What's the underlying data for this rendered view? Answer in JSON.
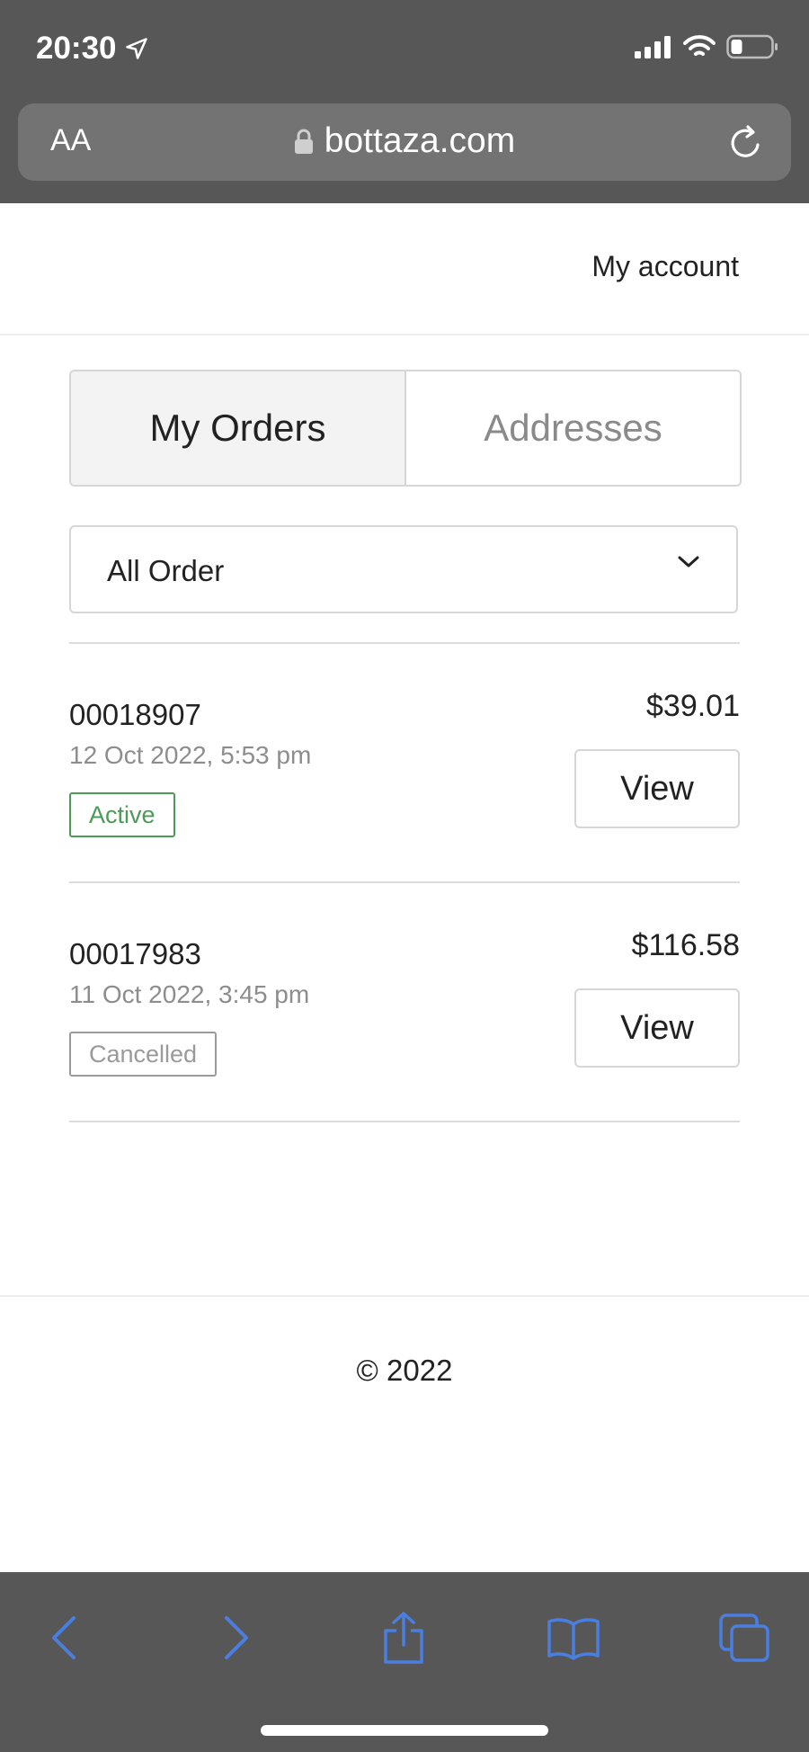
{
  "status_bar": {
    "time": "20:30",
    "icons": [
      "location-arrow-icon",
      "signal-icon",
      "wifi-icon",
      "battery-icon"
    ]
  },
  "url_bar": {
    "text_size_label": "AA",
    "domain": "bottaza.com",
    "icons": [
      "lock-icon",
      "reload-icon"
    ]
  },
  "header": {
    "account_link": "My account"
  },
  "tabs": [
    {
      "label": "My Orders",
      "active": true
    },
    {
      "label": "Addresses",
      "active": false
    }
  ],
  "filter": {
    "selected": "All Order"
  },
  "orders": [
    {
      "number": "00018907",
      "date": "12 Oct 2022, 5:53 pm",
      "status": "Active",
      "price": "$39.01",
      "action": "View"
    },
    {
      "number": "00017983",
      "date": "11 Oct 2022, 3:45 pm",
      "status": "Cancelled",
      "price": "$116.58",
      "action": "View"
    }
  ],
  "footer": {
    "copyright": "© 2022"
  },
  "toolbar": {
    "icons": [
      "back-icon",
      "forward-icon",
      "share-icon",
      "bookmarks-icon",
      "tabs-icon"
    ]
  },
  "colors": {
    "browser_chrome": "#575757",
    "toolbar_icon": "#4a7fe0",
    "active_badge": "#4d9a58",
    "cancelled_badge": "#9a9a9a"
  }
}
